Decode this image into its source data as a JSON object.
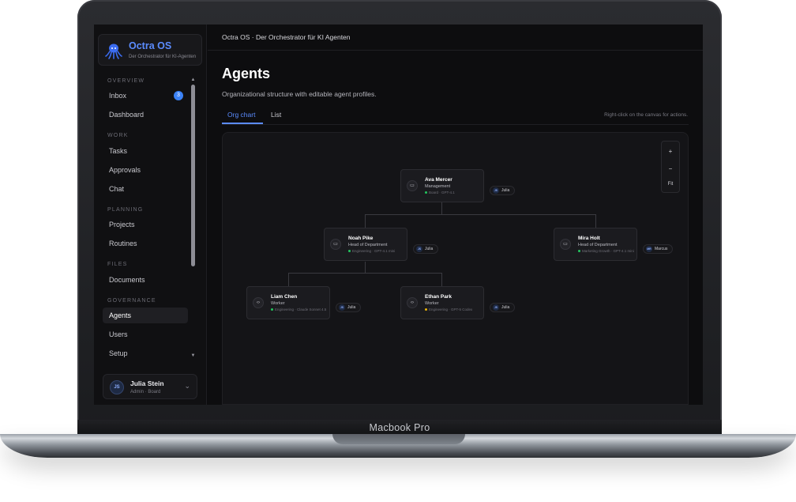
{
  "device": {
    "label": "Macbook Pro"
  },
  "brand": {
    "name": "Octra OS",
    "subtitle": "Der Orchestrator für KI-Agenten"
  },
  "sidebar": {
    "sections": [
      {
        "title": "OVERVIEW",
        "items": [
          {
            "label": "Inbox",
            "badge": "3"
          },
          {
            "label": "Dashboard"
          }
        ]
      },
      {
        "title": "WORK",
        "items": [
          {
            "label": "Tasks"
          },
          {
            "label": "Approvals"
          },
          {
            "label": "Chat"
          }
        ]
      },
      {
        "title": "PLANNING",
        "items": [
          {
            "label": "Projects"
          },
          {
            "label": "Routines"
          }
        ]
      },
      {
        "title": "FILES",
        "items": [
          {
            "label": "Documents"
          }
        ]
      },
      {
        "title": "GOVERNANCE",
        "items": [
          {
            "label": "Agents",
            "active": true
          },
          {
            "label": "Users"
          },
          {
            "label": "Setup"
          }
        ]
      }
    ],
    "user": {
      "initials": "JS",
      "name": "Julia Stein",
      "role": "Admin · Board"
    }
  },
  "topbar": {
    "title": "Octra OS · Der Orchestrator für KI Agenten"
  },
  "page": {
    "title": "Agents",
    "description": "Organizational structure with editable agent profiles.",
    "tabs": [
      {
        "label": "Org chart",
        "active": true
      },
      {
        "label": "List"
      }
    ],
    "hint": "Right-click on the canvas for actions."
  },
  "zoom": {
    "in": "+",
    "out": "−",
    "fit": "Fit"
  },
  "org_chart": {
    "nodes": [
      {
        "id": "ava",
        "name": "Ava Mercer",
        "role": "Management",
        "meta": "Board · GPT-4.1",
        "status_color": "#22c55e",
        "icon": "briefcase-icon",
        "owner_initials": "JS",
        "owner": "Julia"
      },
      {
        "id": "noah",
        "name": "Noah Pike",
        "role": "Head of Department",
        "meta": "Engineering · GPT-4.1 mini",
        "status_color": "#22c55e",
        "icon": "briefcase-icon",
        "owner_initials": "JS",
        "owner": "Julia"
      },
      {
        "id": "mira",
        "name": "Mira Holt",
        "role": "Head of Department",
        "meta": "Marketing Growth · GPT-4.1 mini",
        "status_color": "#22c55e",
        "icon": "briefcase-icon",
        "owner_initials": "MR",
        "owner": "Marcus"
      },
      {
        "id": "liam",
        "name": "Liam Chen",
        "role": "Worker",
        "meta": "Engineering · Claude Sonnet 4.5",
        "status_color": "#22c55e",
        "icon": "code-icon",
        "owner_initials": "JS",
        "owner": "Julia"
      },
      {
        "id": "ethan",
        "name": "Ethan Park",
        "role": "Worker",
        "meta": "Engineering · GPT-5 Codex",
        "status_color": "#eab308",
        "icon": "code-icon",
        "owner_initials": "JS",
        "owner": "Julia"
      }
    ]
  },
  "colors": {
    "accent": "#5b8cff",
    "status_ok": "#22c55e",
    "status_warn": "#eab308"
  }
}
